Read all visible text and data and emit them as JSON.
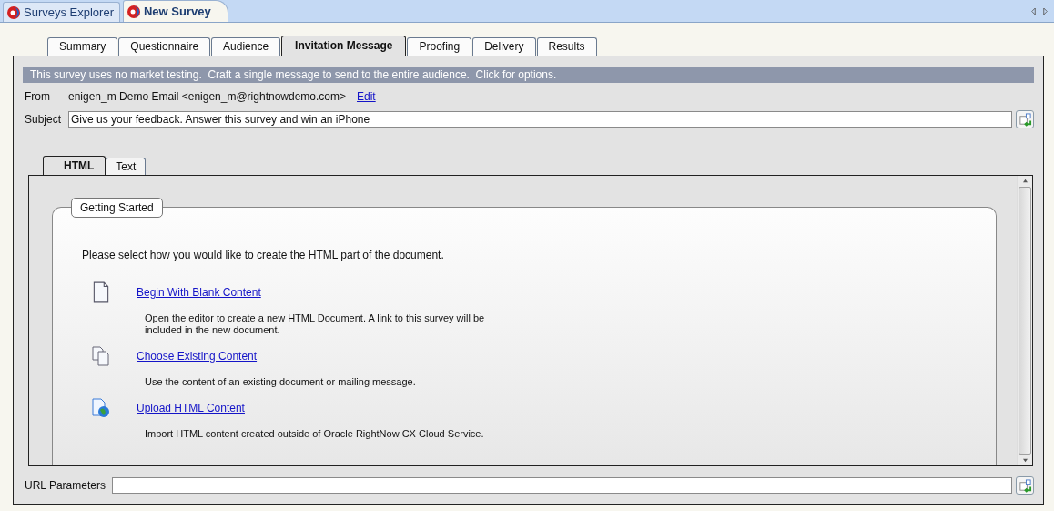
{
  "document_tabs": [
    {
      "label": "Surveys Explorer",
      "selected": false
    },
    {
      "label": "New Survey",
      "selected": true
    }
  ],
  "tabs": [
    {
      "label": "Summary",
      "selected": false
    },
    {
      "label": "Questionnaire",
      "selected": false
    },
    {
      "label": "Audience",
      "selected": false
    },
    {
      "label": "Invitation Message",
      "selected": true
    },
    {
      "label": "Proofing",
      "selected": false
    },
    {
      "label": "Delivery",
      "selected": false
    },
    {
      "label": "Results",
      "selected": false
    }
  ],
  "banner": "This survey uses no market testing.  Craft a single message to send to the entire audience.  Click for options.",
  "from": {
    "label": "From",
    "value": "enigen_m Demo Email <enigen_m@rightnowdemo.com>",
    "link": "Edit"
  },
  "subject": {
    "label": "Subject",
    "value": "Give us your feedback. Answer this survey and win an iPhone"
  },
  "format_tabs": [
    {
      "label": "HTML",
      "selected": true
    },
    {
      "label": "Text",
      "selected": false
    }
  ],
  "group": {
    "title": "Getting Started",
    "intro": "Please select how you would like to create the HTML part of the document.",
    "options": [
      {
        "kind": "blank",
        "link": "Begin With Blank Content",
        "description": "Open the editor to create a new HTML Document. A link to this survey will be included in the new document."
      },
      {
        "kind": "existing",
        "link": "Choose Existing Content",
        "description": "Use the content of an existing document or mailing message."
      },
      {
        "kind": "upload",
        "link": "Upload HTML Content",
        "description": "Import HTML content created outside of Oracle RightNow CX Cloud Service."
      }
    ]
  },
  "url_parameters": {
    "label": "URL Parameters"
  }
}
